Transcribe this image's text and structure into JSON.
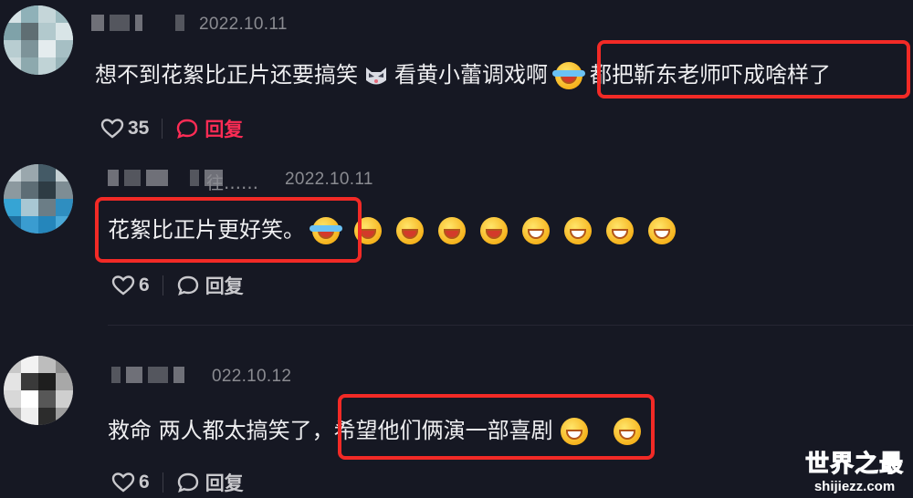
{
  "comments": [
    {
      "date": "2022.10.11",
      "text_part1": "想不到花絮比正片还要搞笑",
      "emoji1": "cat-face",
      "text_part2": "看黄小蕾调戏啊",
      "emoji2": "crying-laughing",
      "highlighted_text": "都把靳东老师吓成啥样了",
      "likes": "35",
      "reply_label": "回复",
      "reply_active": true
    },
    {
      "name_suffix": "往……",
      "date": "2022.10.11",
      "highlighted_text": "花絮比正片更好笑。",
      "emojis": [
        "crying-laughing",
        "laughing",
        "laughing",
        "laughing",
        "laughing",
        "grinning",
        "grinning",
        "grinning",
        "grinning"
      ],
      "likes": "6",
      "reply_label": "回复",
      "reply_active": false
    },
    {
      "date": "022.10.12",
      "text_part1": "救命 两人都太搞笑了，",
      "highlighted_text": "希望他们俩演一部喜剧",
      "emojis": [
        "grinning",
        "grinning"
      ],
      "likes": "6",
      "reply_label": "回复",
      "reply_active": false
    }
  ],
  "watermark": {
    "title": "世界之最",
    "url": "shijiezz.com"
  },
  "colors": {
    "background": "#161823",
    "highlight_box": "#f22a26",
    "reply_active": "#fe2c55"
  }
}
